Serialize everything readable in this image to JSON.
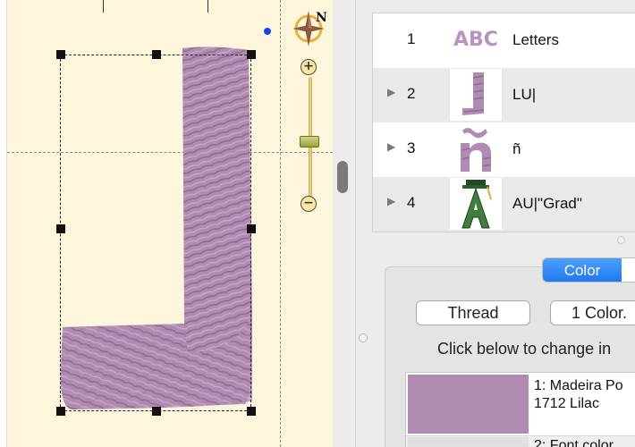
{
  "canvas": {
    "background": "#fdf6dd",
    "letter_color": "#b08cb2",
    "compass_letter": "N",
    "zoom_in_symbol": "+",
    "zoom_out_symbol": "−"
  },
  "objects": [
    {
      "number": "1",
      "label": "Letters",
      "thumb_text": "ABC",
      "icon": "letters-abc-icon",
      "expandable": false,
      "selected": false
    },
    {
      "number": "2",
      "label": "LU|",
      "icon": "letter-l-thumbnail",
      "expandable": true,
      "selected": true
    },
    {
      "number": "3",
      "label": "ñ",
      "icon": "letter-n-tilde-thumbnail",
      "expandable": true,
      "selected": false
    },
    {
      "number": "4",
      "label": "AU|\"Grad\"",
      "icon": "letter-a-grad-thumbnail",
      "expandable": true,
      "selected": false
    }
  ],
  "color_panel": {
    "tab_active": "Color",
    "thread_button": "Thread",
    "color_count_button": "1 Color.",
    "hint": "Click below to change in",
    "colors": [
      {
        "name_line1": "1: Madeira Po",
        "name_line2": "1712 Lilac",
        "swatch": "#b08cb2"
      },
      {
        "name_line1": "2: Font color",
        "name_line2": "",
        "swatch": "#e0e0e0"
      }
    ]
  },
  "accent": "#1b76f0"
}
